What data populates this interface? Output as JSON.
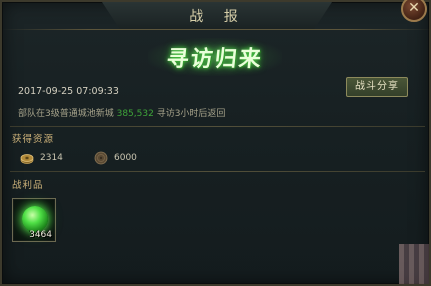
{
  "header": {
    "title": "战 报"
  },
  "banner": {
    "text": "寻访归来"
  },
  "report": {
    "timestamp": "2017-09-25 07:09:33",
    "share_label": "战斗分享",
    "message_prefix": "部队在3级普通城池新城",
    "message_coord": "385,532",
    "message_suffix": "寻访3小时后返回"
  },
  "resources": {
    "label": "获得资源",
    "items": [
      {
        "icon": "copper-coin-icon",
        "value": "2314"
      },
      {
        "icon": "wood-log-icon",
        "value": "6000"
      }
    ]
  },
  "loot": {
    "label": "战利品",
    "items": [
      {
        "icon": "green-jade-icon",
        "count": "3464"
      }
    ]
  },
  "colors": {
    "accent_green": "#3fa43a",
    "section_gold": "#cdb27a",
    "panel_bg": "#172022"
  }
}
